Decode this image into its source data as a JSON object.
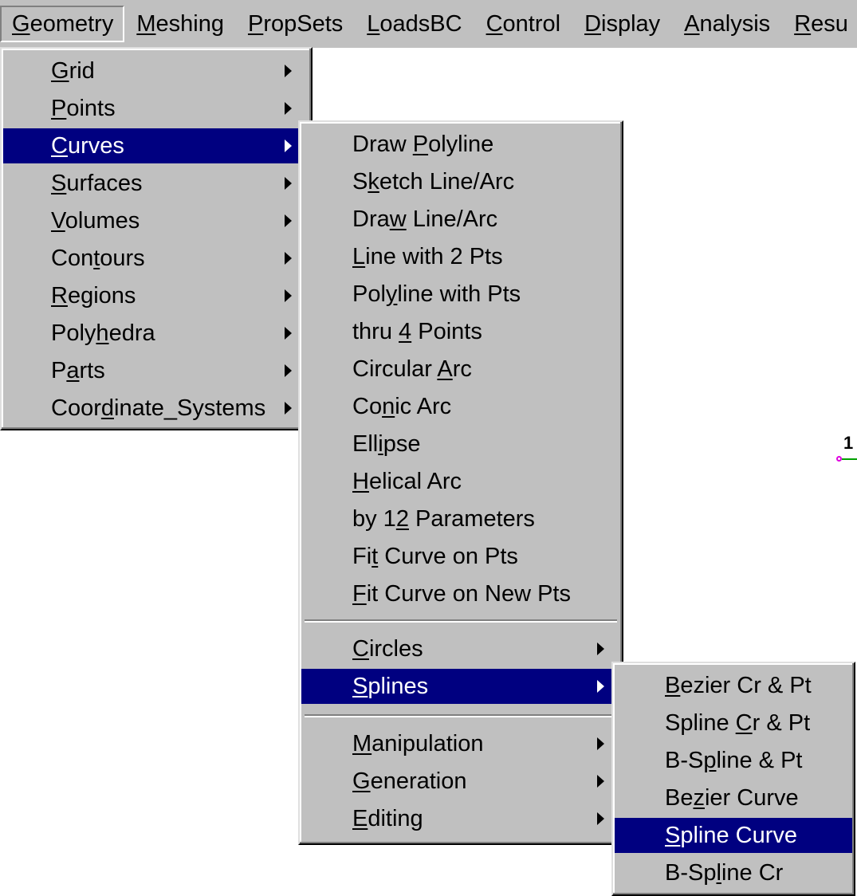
{
  "menubar": [
    {
      "pre": "",
      "acc": "G",
      "post": "eometry"
    },
    {
      "pre": "",
      "acc": "M",
      "post": "eshing"
    },
    {
      "pre": "",
      "acc": "P",
      "post": "ropSets"
    },
    {
      "pre": "",
      "acc": "L",
      "post": "oadsBC"
    },
    {
      "pre": "",
      "acc": "C",
      "post": "ontrol"
    },
    {
      "pre": "",
      "acc": "D",
      "post": "isplay"
    },
    {
      "pre": "",
      "acc": "A",
      "post": "nalysis"
    },
    {
      "pre": "",
      "acc": "R",
      "post": "esu"
    }
  ],
  "geometry_menu": [
    {
      "pre": "",
      "acc": "G",
      "post": "rid"
    },
    {
      "pre": "",
      "acc": "P",
      "post": "oints"
    },
    {
      "pre": "",
      "acc": "C",
      "post": "urves"
    },
    {
      "pre": "",
      "acc": "S",
      "post": "urfaces"
    },
    {
      "pre": "",
      "acc": "V",
      "post": "olumes"
    },
    {
      "pre": "Con",
      "acc": "t",
      "post": "ours"
    },
    {
      "pre": "",
      "acc": "R",
      "post": "egions"
    },
    {
      "pre": "Poly",
      "acc": "h",
      "post": "edra"
    },
    {
      "pre": "P",
      "acc": "a",
      "post": "rts"
    },
    {
      "pre": "Coor",
      "acc": "d",
      "post": "inate_Systems"
    }
  ],
  "curves_menu": [
    {
      "pre": "Draw ",
      "acc": "P",
      "post": "olyline"
    },
    {
      "pre": "S",
      "acc": "k",
      "post": "etch Line/Arc"
    },
    {
      "pre": "Dra",
      "acc": "w",
      "post": " Line/Arc"
    },
    {
      "pre": "",
      "acc": "L",
      "post": "ine with 2 Pts"
    },
    {
      "pre": "Pol",
      "acc": "y",
      "post": "line with Pts"
    },
    {
      "pre": "thru ",
      "acc": "4",
      "post": " Points"
    },
    {
      "pre": "Circular ",
      "acc": "A",
      "post": "rc"
    },
    {
      "pre": "Co",
      "acc": "n",
      "post": "ic Arc"
    },
    {
      "pre": "Ell",
      "acc": "i",
      "post": "pse"
    },
    {
      "pre": "",
      "acc": "H",
      "post": "elical Arc"
    },
    {
      "pre": "by 1",
      "acc": "2",
      "post": " Parameters"
    },
    {
      "pre": "Fi",
      "acc": "t",
      "post": " Curve on Pts"
    },
    {
      "pre": "",
      "acc": "F",
      "post": "it Curve on New Pts"
    },
    {
      "pre": "",
      "acc": "C",
      "post": "ircles"
    },
    {
      "pre": "",
      "acc": "S",
      "post": "plines"
    },
    {
      "pre": "",
      "acc": "M",
      "post": "anipulation"
    },
    {
      "pre": "",
      "acc": "G",
      "post": "eneration"
    },
    {
      "pre": "",
      "acc": "E",
      "post": "diting"
    }
  ],
  "splines_menu": [
    {
      "pre": "",
      "acc": "B",
      "post": "ezier Cr & Pt"
    },
    {
      "pre": "Spline ",
      "acc": "C",
      "post": "r & Pt"
    },
    {
      "pre": "B-S",
      "acc": "p",
      "post": "line & Pt"
    },
    {
      "pre": "Be",
      "acc": "z",
      "post": "ier Curve"
    },
    {
      "pre": "",
      "acc": "S",
      "post": "pline Curve"
    },
    {
      "pre": "B-Sp",
      "acc": "l",
      "post": "ine Cr"
    }
  ],
  "canvas": {
    "point_label": "1"
  },
  "colors": {
    "highlight": "#000080",
    "menu_bg": "#c0c0c0",
    "point": "#e000e0",
    "line": "#00a000"
  }
}
